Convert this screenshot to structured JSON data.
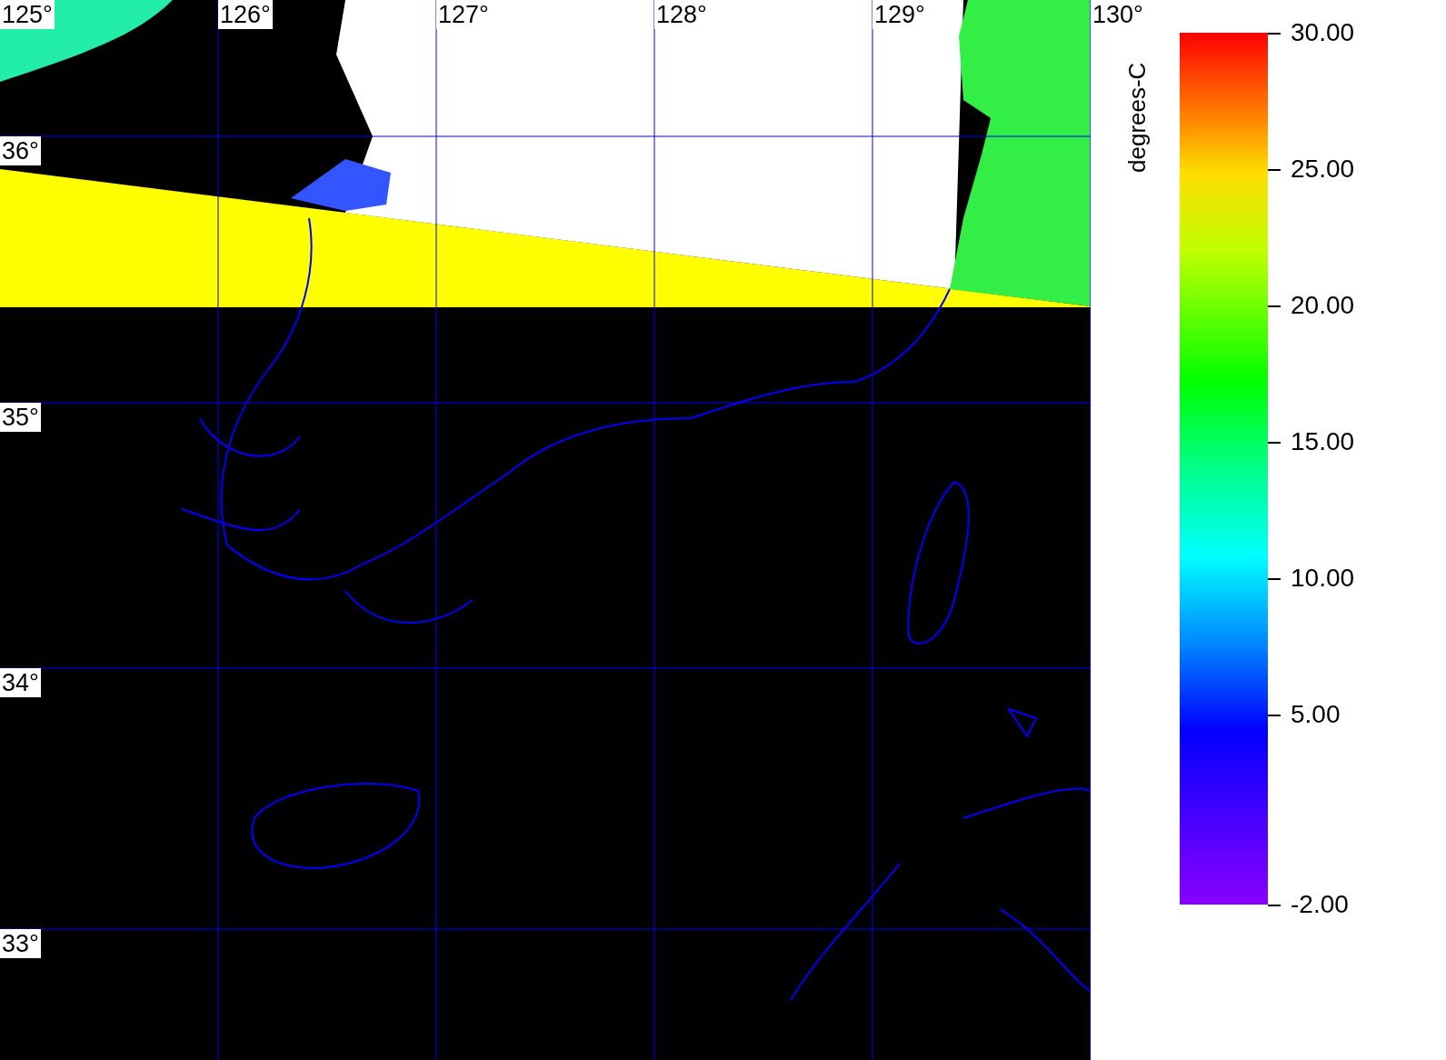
{
  "map": {
    "longitude_labels": [
      "125°",
      "126°",
      "127°",
      "128°",
      "129°",
      "130°"
    ],
    "latitude_labels": [
      "36°",
      "35°",
      "34°",
      "33°"
    ]
  },
  "legend": {
    "title": "degrees-C",
    "ticks": [
      "30.00",
      "25.00",
      "20.00",
      "15.00",
      "10.00",
      "5.00",
      "-2.00"
    ]
  }
}
